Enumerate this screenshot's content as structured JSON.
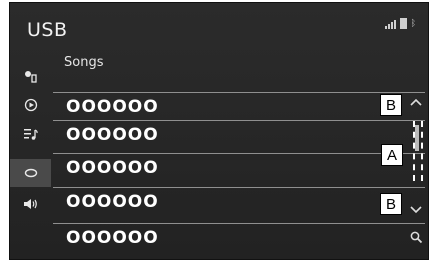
{
  "header": {
    "title": "USB"
  },
  "list": {
    "header": "Songs",
    "rows": [
      "OOOOOO",
      "OOOOOO",
      "OOOOOO",
      "OOOOOO",
      "OOOOOO"
    ]
  },
  "callouts": {
    "b_top": "B",
    "a": "A",
    "b_bottom": "B"
  },
  "icons": {
    "sidebar": [
      "source-settings-icon",
      "play-icon",
      "playlist-icon",
      "browse-icon",
      "volume-icon"
    ],
    "controls": [
      "chevron-up-icon",
      "chevron-down-icon",
      "search-icon"
    ]
  }
}
